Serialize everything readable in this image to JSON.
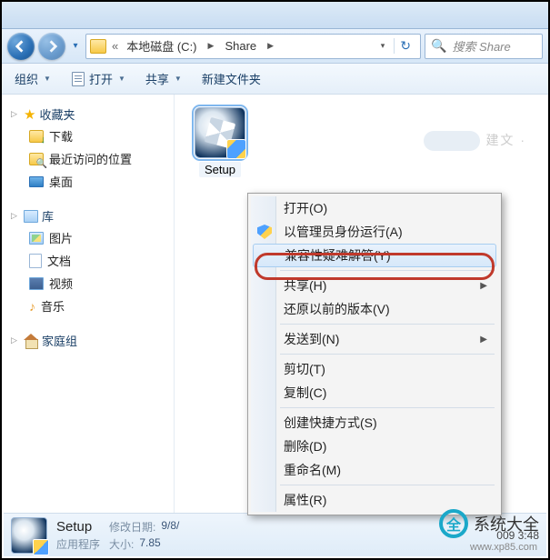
{
  "breadcrumb": {
    "drive": "本地磁盘 (C:)",
    "folder": "Share",
    "prefix": "«"
  },
  "search": {
    "placeholder": "搜索 Share"
  },
  "toolbar": {
    "organize": "组织",
    "open": "打开",
    "share": "共享",
    "newfolder": "新建文件夹"
  },
  "sidebar": {
    "favorites": {
      "label": "收藏夹",
      "downloads": "下载",
      "recent": "最近访问的位置",
      "desktop": "桌面"
    },
    "libraries": {
      "label": "库",
      "pictures": "图片",
      "documents": "文档",
      "videos": "视频",
      "music": "音乐"
    },
    "homegroup": {
      "label": "家庭组"
    }
  },
  "file": {
    "name": "Setup"
  },
  "cloud_hint": "建文",
  "context_menu": {
    "open": "打开(O)",
    "runas": "以管理员身份运行(A)",
    "compat": "兼容性疑难解答(Y)",
    "share": "共享(H)",
    "restore": "还原以前的版本(V)",
    "sendto": "发送到(N)",
    "cut": "剪切(T)",
    "copy": "复制(C)",
    "shortcut": "创建快捷方式(S)",
    "delete": "删除(D)",
    "rename": "重命名(M)",
    "properties": "属性(R)"
  },
  "statusbar": {
    "title": "Setup",
    "subtitle": "应用程序",
    "date_label": "修改日期:",
    "date_value": "9/8/",
    "size_label": "大小:",
    "size_value": "7.85",
    "far_right": "009 3:48"
  },
  "watermark": {
    "text": "系统大全",
    "glyph": "全",
    "url": "www.xp85.com"
  }
}
